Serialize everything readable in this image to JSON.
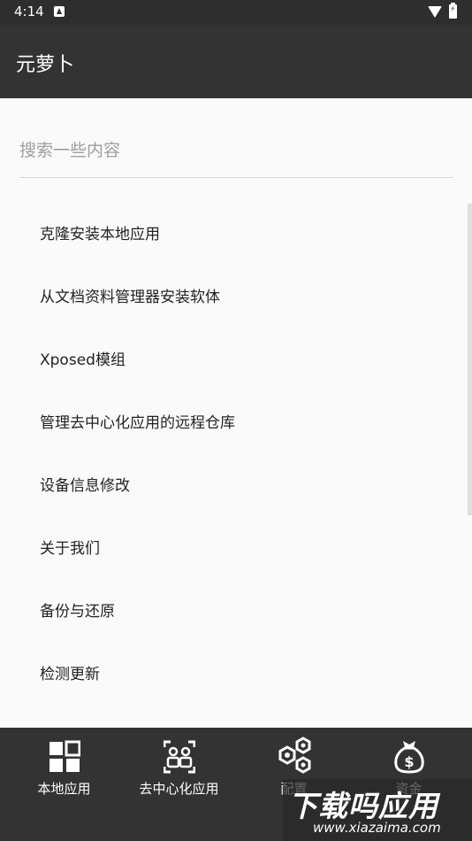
{
  "status_bar": {
    "time": "4:14"
  },
  "app_bar": {
    "title": "元萝卜"
  },
  "search": {
    "placeholder": "搜索一些内容"
  },
  "menu": {
    "items": [
      {
        "label": "克隆安装本地应用"
      },
      {
        "label": "从文档资料管理器安装软体"
      },
      {
        "label": "Xposed模组"
      },
      {
        "label": "管理去中心化应用的远程仓库"
      },
      {
        "label": "设备信息修改"
      },
      {
        "label": "关于我们"
      },
      {
        "label": "备份与还原"
      },
      {
        "label": "检测更新"
      }
    ]
  },
  "bottom_nav": {
    "items": [
      {
        "label": "本地应用",
        "icon": "grid-icon"
      },
      {
        "label": "去中心化应用",
        "icon": "people-scan-icon"
      },
      {
        "label": "配置",
        "icon": "hexagon-nodes-icon"
      },
      {
        "label": "资金",
        "icon": "money-bag-icon"
      }
    ]
  },
  "watermark": {
    "main": "下载吗应用",
    "sub": "www.xiazaima.com"
  },
  "colors": {
    "bar_bg": "#333333",
    "page_bg": "#fafafa",
    "text": "#222222"
  }
}
